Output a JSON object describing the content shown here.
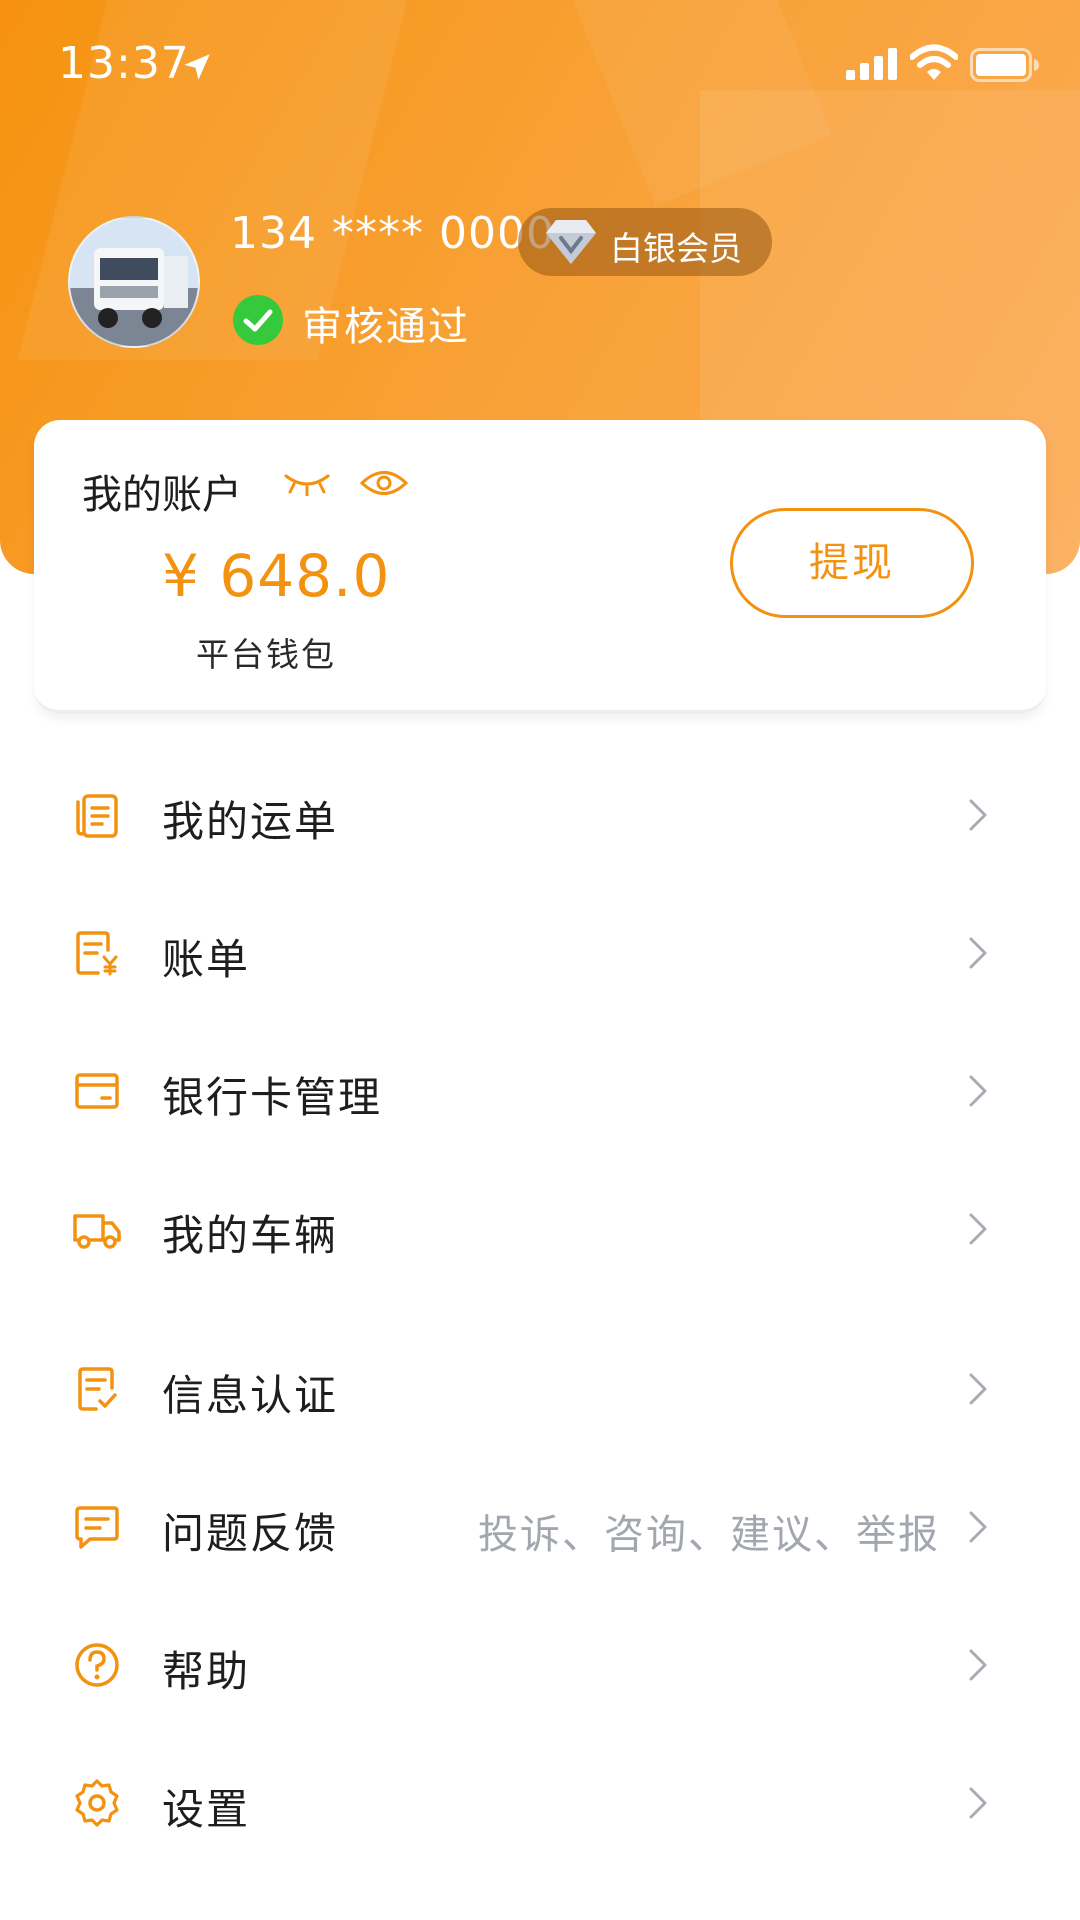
{
  "status_bar": {
    "time": "13:37"
  },
  "profile": {
    "phone": "134 **** 0000",
    "membership": "白银会员",
    "verification": "审核通过"
  },
  "account": {
    "title": "我的账户",
    "amount": "¥ 648.0",
    "wallet_label": "平台钱包",
    "withdraw_label": "提现"
  },
  "menu": [
    {
      "label": "我的运单",
      "icon": "waybill-icon"
    },
    {
      "label": "账单",
      "icon": "bill-icon"
    },
    {
      "label": "银行卡管理",
      "icon": "bank-card-icon"
    },
    {
      "label": "我的车辆",
      "icon": "truck-icon"
    },
    {
      "label": "信息认证",
      "icon": "certification-icon"
    },
    {
      "label": "问题反馈",
      "icon": "feedback-icon",
      "hint": "投诉、咨询、建议、举报"
    },
    {
      "label": "帮助",
      "icon": "help-icon"
    },
    {
      "label": "设置",
      "icon": "settings-icon"
    }
  ],
  "colors": {
    "accent": "#f39211",
    "header_start": "#f6920f",
    "header_end": "#fbac56",
    "verified": "#35c93b"
  }
}
